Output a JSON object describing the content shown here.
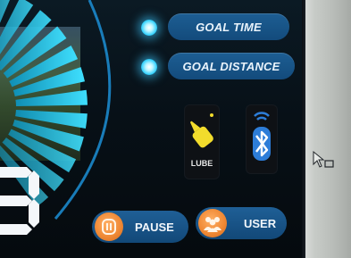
{
  "status_buttons": {
    "goal_time_label": "GOAL TIME",
    "goal_distance_label": "GOAL DISTANCE"
  },
  "indicators": {
    "lube_label": "LUBE"
  },
  "controls": {
    "pause_label": "PAUSE",
    "user_label": "USER"
  },
  "colors": {
    "button_blue": "#17568a",
    "indicator_glow": "#35d2ff",
    "accent_orange": "#f08a36",
    "lube_yellow": "#f2dc2c",
    "bezel_gray": "#c7cbc7"
  },
  "icons": [
    "lube-bottle-icon",
    "bluetooth-icon",
    "pause-icon",
    "users-icon",
    "cursor-arrow-icon"
  ]
}
